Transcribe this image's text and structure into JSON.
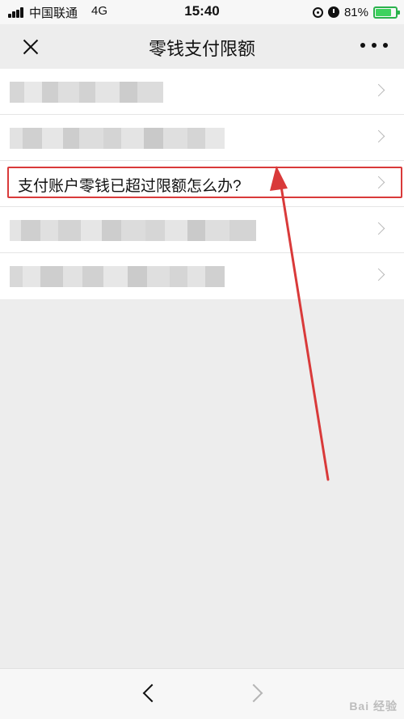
{
  "status_bar": {
    "carrier": "中国联通",
    "network": "4G",
    "time": "15:40",
    "battery": "81%",
    "battery_level": 0.81,
    "icons": [
      "signal-icon",
      "orientation-lock-icon",
      "alarm-icon",
      "battery-icon"
    ]
  },
  "nav": {
    "title": "零钱支付限额",
    "icons": [
      "close-icon",
      "more-icon"
    ]
  },
  "list": {
    "items": [
      {
        "label": "",
        "blurred": true
      },
      {
        "label": "",
        "blurred": true
      },
      {
        "label": "支付账户零钱已超过限额怎么办?",
        "blurred": false,
        "highlighted": true
      },
      {
        "label": "",
        "blurred": true
      },
      {
        "label": "",
        "blurred": true
      }
    ]
  },
  "annotation": {
    "color": "#d93a3a"
  },
  "bottom_bar": {
    "icons": [
      "back-icon",
      "forward-icon"
    ],
    "watermark": "Bai 经验"
  }
}
